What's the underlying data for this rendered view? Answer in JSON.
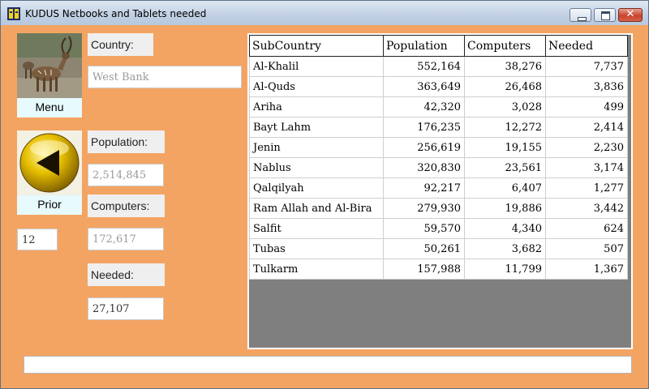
{
  "window": {
    "title": "KUDUS Netbooks and Tablets needed",
    "buttons": [
      "minimize",
      "maximize",
      "close"
    ]
  },
  "nav": {
    "menu_label": "Menu",
    "prior_label": "Prior",
    "record_number": "12"
  },
  "fields": {
    "country_label": "Country:",
    "country_value": "West Bank",
    "population_label": "Population:",
    "population_value": "2,514,845",
    "computers_label": "Computers:",
    "computers_value": "172,617",
    "needed_label": "Needed:",
    "needed_value": "27,107"
  },
  "table": {
    "columns": [
      "SubCountry",
      "Population",
      "Computers",
      "Needed"
    ],
    "rows": [
      [
        "Al-Khalil",
        "552,164",
        "38,276",
        "7,737"
      ],
      [
        "Al-Quds",
        "363,649",
        "26,468",
        "3,836"
      ],
      [
        "Ariha",
        "42,320",
        "3,028",
        "499"
      ],
      [
        "Bayt Lahm",
        "176,235",
        "12,272",
        "2,414"
      ],
      [
        "Jenin",
        "256,619",
        "19,155",
        "2,230"
      ],
      [
        "Nablus",
        "320,830",
        "23,561",
        "3,174"
      ],
      [
        "Qalqilyah",
        "92,217",
        "6,407",
        "1,277"
      ],
      [
        "Ram Allah and Al-Bira",
        "279,930",
        "19,886",
        "3,442"
      ],
      [
        "Salfit",
        "59,570",
        "4,340",
        "624"
      ],
      [
        "Tubas",
        "50,261",
        "3,682",
        "507"
      ],
      [
        "Tulkarm",
        "157,988",
        "11,799",
        "1,367"
      ]
    ]
  },
  "status": {
    "text": ""
  },
  "colors": {
    "background": "#f4a462",
    "grid_empty": "#7f7f7f",
    "tile": "#e7fafe"
  }
}
